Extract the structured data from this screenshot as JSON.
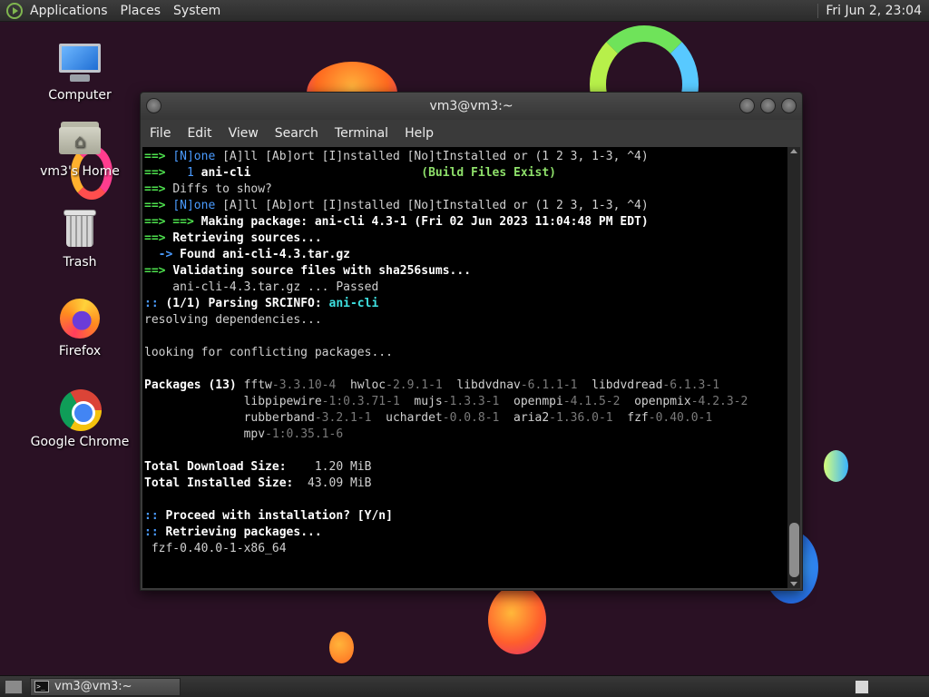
{
  "top_panel": {
    "menus": [
      "Applications",
      "Places",
      "System"
    ],
    "clock": "Fri Jun  2, 23:04"
  },
  "desktop_icons": [
    {
      "label": "Computer",
      "icon": "computer-icon"
    },
    {
      "label": "vm3's Home",
      "icon": "home-folder-icon"
    },
    {
      "label": "Trash",
      "icon": "trash-icon"
    },
    {
      "label": "Firefox",
      "icon": "firefox-icon"
    },
    {
      "label": "Google Chrome",
      "icon": "chrome-icon"
    }
  ],
  "terminal": {
    "title": "vm3@vm3:~",
    "menu": [
      "File",
      "Edit",
      "View",
      "Search",
      "Terminal",
      "Help"
    ],
    "lines": [
      [
        [
          "g",
          "==> "
        ],
        [
          "b",
          "[N]one "
        ],
        [
          "n",
          "[A]ll [Ab]ort [I]nstalled [No]tInstalled or (1 2 3, 1-3, ^4)"
        ]
      ],
      [
        [
          "g",
          "==>   "
        ],
        [
          "b",
          "1 "
        ],
        [
          "w",
          "ani-cli"
        ],
        [
          "n",
          "                        "
        ],
        [
          "lg",
          "(Build Files Exist)"
        ]
      ],
      [
        [
          "g",
          "==> "
        ],
        [
          "n",
          "Diffs to show?"
        ]
      ],
      [
        [
          "g",
          "==> "
        ],
        [
          "b",
          "[N]one "
        ],
        [
          "n",
          "[A]ll [Ab]ort [I]nstalled [No]tInstalled or (1 2 3, 1-3, ^4)"
        ]
      ],
      [
        [
          "g",
          "==> ==> "
        ],
        [
          "w",
          "Making package: ani-cli 4.3-1 (Fri 02 Jun 2023 11:04:48 PM EDT)"
        ]
      ],
      [
        [
          "g",
          "==> "
        ],
        [
          "w",
          "Retrieving sources..."
        ]
      ],
      [
        [
          "bb",
          "  -> "
        ],
        [
          "w",
          "Found ani-cli-4.3.tar.gz"
        ]
      ],
      [
        [
          "g",
          "==> "
        ],
        [
          "w",
          "Validating source files with sha256sums..."
        ]
      ],
      [
        [
          "n",
          "    ani-cli-4.3.tar.gz ... Passed"
        ]
      ],
      [
        [
          "bb",
          ":: "
        ],
        [
          "w",
          "(1/1) Parsing SRCINFO: "
        ],
        [
          "cy",
          "ani-cli"
        ]
      ],
      [
        [
          "n",
          "resolving dependencies..."
        ]
      ],
      [
        [
          "n",
          ""
        ]
      ],
      [
        [
          "n",
          "looking for conflicting packages..."
        ]
      ],
      [
        [
          "n",
          ""
        ]
      ],
      [
        [
          "w",
          "Packages (13) "
        ],
        [
          "n",
          "fftw"
        ],
        [
          "gr",
          "-3.3.10-4  "
        ],
        [
          "n",
          "hwloc"
        ],
        [
          "gr",
          "-2.9.1-1  "
        ],
        [
          "n",
          "libdvdnav"
        ],
        [
          "gr",
          "-6.1.1-1  "
        ],
        [
          "n",
          "libdvdread"
        ],
        [
          "gr",
          "-6.1.3-1"
        ]
      ],
      [
        [
          "n",
          "              libpipewire"
        ],
        [
          "gr",
          "-1:0.3.71-1  "
        ],
        [
          "n",
          "mujs"
        ],
        [
          "gr",
          "-1.3.3-1  "
        ],
        [
          "n",
          "openmpi"
        ],
        [
          "gr",
          "-4.1.5-2  "
        ],
        [
          "n",
          "openpmix"
        ],
        [
          "gr",
          "-4.2.3-2"
        ]
      ],
      [
        [
          "n",
          "              rubberband"
        ],
        [
          "gr",
          "-3.2.1-1  "
        ],
        [
          "n",
          "uchardet"
        ],
        [
          "gr",
          "-0.0.8-1  "
        ],
        [
          "n",
          "aria2"
        ],
        [
          "gr",
          "-1.36.0-1  "
        ],
        [
          "n",
          "fzf"
        ],
        [
          "gr",
          "-0.40.0-1"
        ]
      ],
      [
        [
          "n",
          "              mpv"
        ],
        [
          "gr",
          "-1:0.35.1-6"
        ]
      ],
      [
        [
          "n",
          ""
        ]
      ],
      [
        [
          "w",
          "Total Download Size:  "
        ],
        [
          "n",
          "  1.20 MiB"
        ]
      ],
      [
        [
          "w",
          "Total Installed Size: "
        ],
        [
          "n",
          " 43.09 MiB"
        ]
      ],
      [
        [
          "n",
          ""
        ]
      ],
      [
        [
          "bb",
          ":: "
        ],
        [
          "w",
          "Proceed with installation? [Y/n]"
        ]
      ],
      [
        [
          "bb",
          ":: "
        ],
        [
          "w",
          "Retrieving packages..."
        ]
      ],
      [
        [
          "n",
          " fzf-0.40.0-1-x86_64"
        ]
      ]
    ]
  },
  "bottom_panel": {
    "taskbar_item": "vm3@vm3:~",
    "term_icon_text": ">_"
  }
}
